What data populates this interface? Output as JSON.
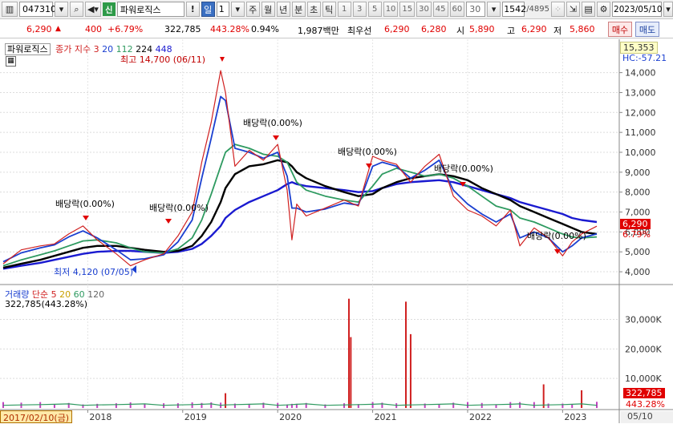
{
  "toolbar": {
    "code": "047310",
    "stock_name": "파워로직스",
    "credit_badge": "신",
    "period_buttons": [
      "일",
      "1",
      "주",
      "월",
      "년",
      "분",
      "초",
      "틱"
    ],
    "interval_buttons": [
      "1",
      "3",
      "5",
      "10",
      "15",
      "30",
      "45",
      "60"
    ],
    "interval_value": "30",
    "count_value": "1542",
    "count_total": "/4895",
    "date_value": "2023/05/10"
  },
  "infobar": {
    "price": "6,290",
    "price_arrow": "▲",
    "change": "400",
    "change_pct": "+6.79%",
    "volume": "322,785",
    "volume_ratio": "443.28%",
    "turnover": "0.94%",
    "amount": "1,987백만",
    "best_ask_label": "최우선",
    "best_ask": "6,290",
    "best_bid": "6,280",
    "open_label": "시",
    "open": "5,890",
    "high_label": "고",
    "high": "6,290",
    "low_label": "저",
    "low": "5,860",
    "buy_label": "매수",
    "sell_label": "매도"
  },
  "price_panel": {
    "name_tag": "파워로직스",
    "legend_label": "종가 지수",
    "ma_periods": [
      "3",
      "20",
      "112",
      "224",
      "448"
    ],
    "ma_colors": [
      "#d02020",
      "#1a3fd0",
      "#2e9a60",
      "#000000",
      "#1a1ad0"
    ],
    "high_annotation": "최고 14,700 (06/11)",
    "low_annotation": "최저 4,120 (07/05)",
    "dividend_label": "배당락(0.00%)",
    "top_value": "15,353",
    "hc_value": "HC:-57.21",
    "current_price_tag": "6,290",
    "current_pct_tag": "6.79%",
    "y_ticks": [
      "14,000",
      "13,000",
      "12,000",
      "11,000",
      "10,000",
      "9,000",
      "8,000",
      "7,000",
      "6,000",
      "5,000",
      "4,000"
    ]
  },
  "volume_panel": {
    "legend_label": "거래량",
    "legend_type": "단순",
    "ma_periods": [
      "5",
      "20",
      "60",
      "120"
    ],
    "ma_colors": [
      "#d02020",
      "#e0c000",
      "#2e9a60",
      "#606060"
    ],
    "sub_label": "322,785(443.28%)",
    "y_ticks": [
      "30,000K",
      "20,000K",
      "10,000K"
    ],
    "volume_tag": "322,785",
    "pct_tag": "443.28%"
  },
  "x_axis": {
    "start_date": "2017/02/10(금)",
    "years": [
      "2018",
      "2019",
      "2020",
      "2021",
      "2022",
      "2023"
    ],
    "end_date": "05/10"
  },
  "chart_data": {
    "type": "line",
    "title": "",
    "x_unit": "year",
    "x": [
      2017.11,
      2017.3,
      2017.5,
      2017.65,
      2017.8,
      2017.95,
      2018.1,
      2018.3,
      2018.45,
      2018.6,
      2018.8,
      2018.95,
      2019.1,
      2019.2,
      2019.3,
      2019.4,
      2019.45,
      2019.55,
      2019.7,
      2019.85,
      2020.0,
      2020.1,
      2020.15,
      2020.2,
      2020.3,
      2020.5,
      2020.7,
      2020.85,
      2021.0,
      2021.1,
      2021.25,
      2021.4,
      2021.55,
      2021.7,
      2021.85,
      2022.0,
      2022.15,
      2022.3,
      2022.45,
      2022.55,
      2022.7,
      2022.85,
      2023.0,
      2023.1,
      2023.2,
      2023.36
    ],
    "series": [
      {
        "name": "종가",
        "color": "#d02020",
        "values": [
          4400,
          5100,
          5300,
          5400,
          5900,
          6300,
          5600,
          4900,
          4300,
          4600,
          4900,
          5800,
          7000,
          9500,
          11500,
          14100,
          13000,
          9300,
          10100,
          9600,
          10400,
          8100,
          5600,
          7400,
          6800,
          7200,
          7600,
          7300,
          9800,
          9600,
          9400,
          8500,
          9300,
          9900,
          7800,
          7100,
          6800,
          6300,
          7100,
          5300,
          6200,
          5700,
          4800,
          5500,
          5900,
          6290
        ]
      },
      {
        "name": "20",
        "color": "#1a3fd0",
        "values": [
          4500,
          4950,
          5200,
          5350,
          5750,
          6050,
          5700,
          5100,
          4600,
          4650,
          4850,
          5500,
          6600,
          8700,
          10700,
          12800,
          12600,
          10200,
          10000,
          9700,
          10000,
          8800,
          7200,
          7200,
          7000,
          7150,
          7450,
          7350,
          9300,
          9500,
          9300,
          8700,
          9100,
          9600,
          8100,
          7400,
          6900,
          6500,
          6900,
          5700,
          6000,
          5700,
          5000,
          5300,
          5700,
          5900
        ]
      },
      {
        "name": "112",
        "color": "#2e9a60",
        "values": [
          4300,
          4600,
          4850,
          5050,
          5300,
          5550,
          5600,
          5450,
          5200,
          5000,
          4950,
          5150,
          5700,
          6600,
          7900,
          9300,
          10000,
          10400,
          10200,
          9900,
          9800,
          9500,
          9000,
          8500,
          8100,
          7800,
          7600,
          7500,
          8300,
          8900,
          9200,
          9000,
          8800,
          8900,
          8700,
          8300,
          7800,
          7300,
          7100,
          6700,
          6500,
          6200,
          5900,
          5750,
          5700,
          5750
        ]
      },
      {
        "name": "224",
        "color": "#000000",
        "values": [
          4200,
          4400,
          4600,
          4800,
          5000,
          5200,
          5300,
          5300,
          5200,
          5100,
          5000,
          5050,
          5300,
          5800,
          6500,
          7500,
          8200,
          8900,
          9300,
          9400,
          9600,
          9500,
          9300,
          9000,
          8700,
          8300,
          8000,
          7800,
          7900,
          8200,
          8500,
          8700,
          8800,
          8900,
          8800,
          8600,
          8200,
          7900,
          7600,
          7300,
          7000,
          6700,
          6400,
          6200,
          6000,
          5900
        ]
      },
      {
        "name": "448",
        "color": "#1a1ad0",
        "values": [
          4150,
          4300,
          4450,
          4600,
          4750,
          4900,
          5000,
          5050,
          5050,
          5000,
          4950,
          5000,
          5150,
          5400,
          5800,
          6300,
          6700,
          7100,
          7500,
          7800,
          8100,
          8400,
          8500,
          8400,
          8300,
          8200,
          8100,
          8000,
          8050,
          8200,
          8400,
          8500,
          8550,
          8600,
          8500,
          8300,
          8100,
          7900,
          7700,
          7500,
          7300,
          7100,
          6900,
          6700,
          6600,
          6500
        ]
      }
    ],
    "ylim": [
      3600,
      15353
    ],
    "volume_ylim": [
      0,
      38000
    ],
    "volume_spikes": [
      {
        "x": 2020.75,
        "v": 37000
      },
      {
        "x": 2020.77,
        "v": 24000
      },
      {
        "x": 2021.35,
        "v": 36000
      },
      {
        "x": 2021.4,
        "v": 25000
      },
      {
        "x": 2022.8,
        "v": 8000
      },
      {
        "x": 2019.45,
        "v": 5000
      },
      {
        "x": 2023.2,
        "v": 6000
      }
    ]
  }
}
